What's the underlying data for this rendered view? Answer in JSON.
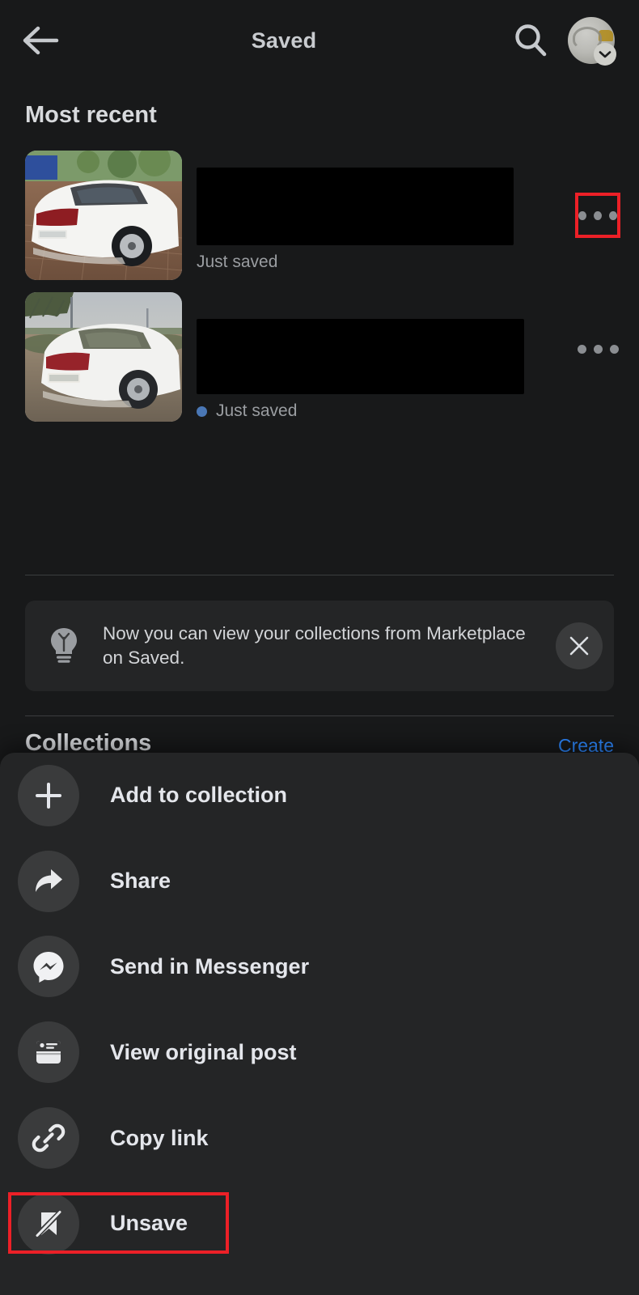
{
  "header": {
    "back_icon": "back-arrow-icon",
    "title": "Saved",
    "search_icon": "search-icon",
    "avatar_icon": "profile-avatar",
    "avatar_badge_icon": "chevron-down-icon"
  },
  "main": {
    "section_title": "Most recent",
    "items": [
      {
        "thumbnail_alt": "white-sedan-rear-on-paved-driveway",
        "title_redacted": true,
        "status": "Just saved",
        "has_blue_dot": false,
        "menu_icon": "three-dots-icon",
        "menu_highlighted": true
      },
      {
        "thumbnail_alt": "white-sedan-rear-at-dusk-roadside",
        "title_redacted": true,
        "status": "Just saved",
        "has_blue_dot": true,
        "menu_icon": "three-dots-icon",
        "menu_highlighted": false
      }
    ],
    "banner": {
      "icon": "lightbulb-icon",
      "text": "Now you can view your collections from Marketplace on Saved.",
      "close_icon": "close-icon"
    },
    "collections": {
      "title": "Collections",
      "create_label": "Create"
    }
  },
  "sheet": {
    "items": [
      {
        "icon": "plus-icon",
        "label": "Add to collection",
        "highlighted": false
      },
      {
        "icon": "share-arrow-icon",
        "label": "Share",
        "highlighted": false
      },
      {
        "icon": "messenger-icon",
        "label": "Send in Messenger",
        "highlighted": false
      },
      {
        "icon": "post-card-icon",
        "label": "View original post",
        "highlighted": false
      },
      {
        "icon": "link-chain-icon",
        "label": "Copy link",
        "highlighted": false
      },
      {
        "icon": "bookmark-slash-icon",
        "label": "Unsave",
        "highlighted": true
      }
    ]
  },
  "colors": {
    "background": "#18191a",
    "sheet_background": "#242526",
    "icon_circle": "#3a3b3c",
    "text_primary": "#e4e6eb",
    "text_secondary": "#9a9da1",
    "accent_blue": "#2d88ff",
    "status_dot_blue": "#4a77b5",
    "highlight_red": "#ec2027"
  }
}
